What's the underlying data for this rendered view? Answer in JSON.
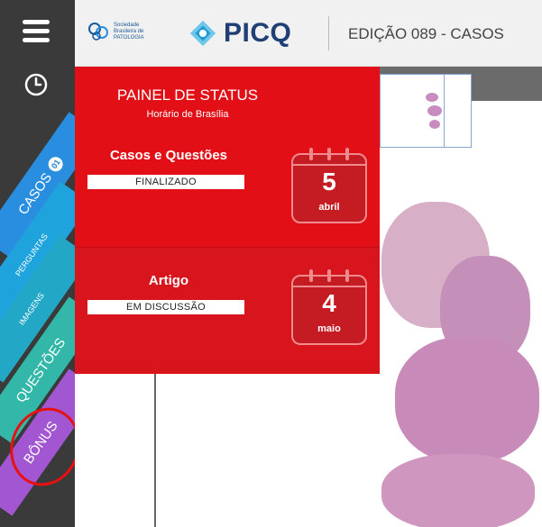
{
  "header": {
    "sbp_logo_text": [
      "Sociedade",
      "Brasileira de",
      "PATOLOGIA"
    ],
    "app_name": "PICQ",
    "edition": "EDIÇÃO 089 - CASOS"
  },
  "sidebar": {
    "items": [
      {
        "label": "CASOS",
        "badge": "01"
      },
      {
        "label": "PERGUNTAS"
      },
      {
        "label": "IMAGENS"
      },
      {
        "label": "QUESTÕES"
      },
      {
        "label": "BÔNUS"
      }
    ]
  },
  "status_panel": {
    "title": "PAINEL DE STATUS",
    "subtitle": "Horário de Brasília",
    "sections": [
      {
        "heading": "Casos e Questões",
        "status": "FINALIZADO",
        "day": "5",
        "month": "abril"
      },
      {
        "heading": "Artigo",
        "status": "EM DISCUSSÃO",
        "day": "4",
        "month": "maio"
      }
    ]
  },
  "colors": {
    "sidebar": "#3a3a3a",
    "panel_red": "#e30f16",
    "casos": "#2a8ee0",
    "questoes": "#32b7a8",
    "bonus": "#a356d2",
    "annotation_circle": "#e81010"
  },
  "icons": [
    "hamburger-menu-icon",
    "clock-icon",
    "calendar-icon",
    "sbp-logo-icon",
    "picq-logo-icon"
  ]
}
